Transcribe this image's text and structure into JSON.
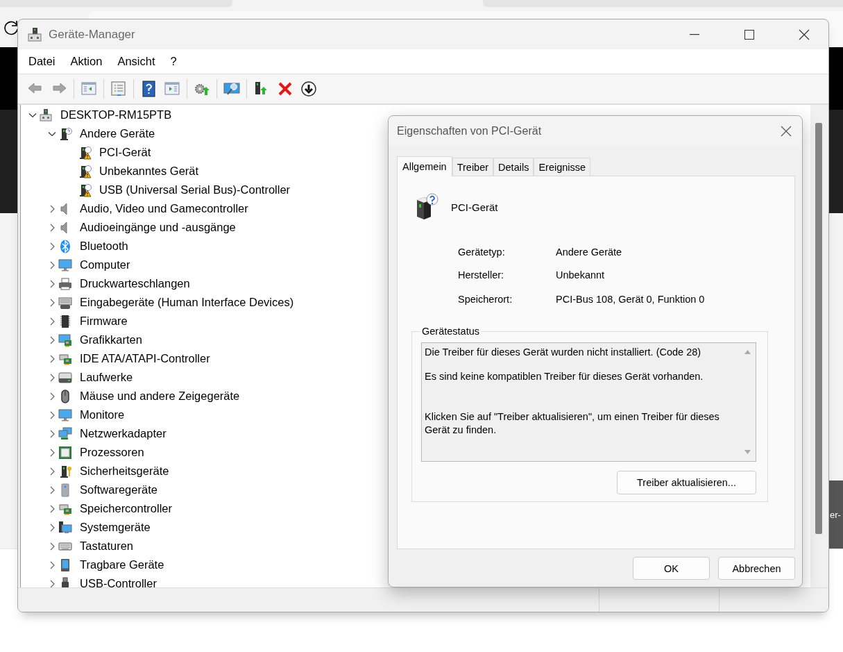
{
  "background": {
    "side_text": "er-"
  },
  "window": {
    "title": "Geräte-Manager"
  },
  "menu": [
    {
      "label": "Datei"
    },
    {
      "label": "Aktion"
    },
    {
      "label": "Ansicht"
    },
    {
      "label": "?"
    }
  ],
  "toolbar": {
    "groups": [
      [
        {
          "kind": "back",
          "disabled": true
        },
        {
          "kind": "forward",
          "disabled": true
        }
      ],
      [
        {
          "kind": "tree",
          "disabled": false
        }
      ],
      [
        {
          "kind": "properties",
          "disabled": false
        }
      ],
      [
        {
          "kind": "help",
          "disabled": false
        },
        {
          "kind": "pane",
          "disabled": false
        }
      ],
      [
        {
          "kind": "update",
          "disabled": false
        }
      ],
      [
        {
          "kind": "scan",
          "disabled": false
        }
      ],
      [
        {
          "kind": "enable",
          "disabled": false
        },
        {
          "kind": "remove",
          "disabled": false
        },
        {
          "kind": "download",
          "disabled": false
        }
      ]
    ]
  },
  "tree": [
    {
      "label": "DESKTOP-RM15PTB",
      "kind": "computer",
      "expanded": true,
      "children": [
        {
          "label": "Andere Geräte",
          "kind": "unknown",
          "expanded": true,
          "children": [
            {
              "label": "PCI-Gerät",
              "kind": "warning"
            },
            {
              "label": "Unbekanntes Gerät",
              "kind": "warning"
            },
            {
              "label": "USB (Universal Serial Bus)-Controller",
              "kind": "warning"
            }
          ]
        },
        {
          "label": "Audio, Video und Gamecontroller",
          "kind": "speaker",
          "expanded": false
        },
        {
          "label": "Audioeingänge und -ausgänge",
          "kind": "speaker",
          "expanded": false
        },
        {
          "label": "Bluetooth",
          "kind": "bluetooth",
          "expanded": false
        },
        {
          "label": "Computer",
          "kind": "monitor",
          "expanded": false
        },
        {
          "label": "Druckwarteschlangen",
          "kind": "printer",
          "expanded": false
        },
        {
          "label": "Eingabegeräte (Human Interface Devices)",
          "kind": "hid",
          "expanded": false
        },
        {
          "label": "Firmware",
          "kind": "chip",
          "expanded": false
        },
        {
          "label": "Grafikkarten",
          "kind": "display",
          "expanded": false
        },
        {
          "label": "IDE ATA/ATAPI-Controller",
          "kind": "card",
          "expanded": false
        },
        {
          "label": "Laufwerke",
          "kind": "drive",
          "expanded": false
        },
        {
          "label": "Mäuse und andere Zeigegeräte",
          "kind": "mouse",
          "expanded": false
        },
        {
          "label": "Monitore",
          "kind": "monitor",
          "expanded": false
        },
        {
          "label": "Netzwerkadapter",
          "kind": "network",
          "expanded": false
        },
        {
          "label": "Prozessoren",
          "kind": "cpu",
          "expanded": false
        },
        {
          "label": "Sicherheitsgeräte",
          "kind": "key",
          "expanded": false
        },
        {
          "label": "Softwaregeräte",
          "kind": "tower",
          "expanded": false
        },
        {
          "label": "Speichercontroller",
          "kind": "card",
          "expanded": false
        },
        {
          "label": "Systemgeräte",
          "kind": "system",
          "expanded": false
        },
        {
          "label": "Tastaturen",
          "kind": "keyboard",
          "expanded": false
        },
        {
          "label": "Tragbare Geräte",
          "kind": "portable",
          "expanded": false
        },
        {
          "label": "USB-Controller",
          "kind": "usb",
          "expanded": false
        }
      ]
    }
  ],
  "dialog": {
    "title": "Eigenschaften von PCI-Gerät",
    "tabs": [
      {
        "label": "Allgemein",
        "selected": true
      },
      {
        "label": "Treiber",
        "selected": false
      },
      {
        "label": "Details",
        "selected": false
      },
      {
        "label": "Ereignisse",
        "selected": false
      }
    ],
    "device_name": "PCI-Gerät",
    "properties": [
      {
        "label": "Gerätetyp:",
        "value": "Andere Geräte"
      },
      {
        "label": "Hersteller:",
        "value": "Unbekannt"
      },
      {
        "label": "Speicherort:",
        "value": "PCI-Bus 108, Gerät 0, Funktion 0"
      }
    ],
    "status": {
      "title": "Gerätestatus",
      "lines": [
        "Die Treiber für dieses Gerät wurden nicht installiert. (Code 28)",
        "Es sind keine kompatiblen Treiber für dieses Gerät vorhanden.",
        "Klicken Sie auf \"Treiber aktualisieren\", um einen Treiber für dieses Gerät zu finden."
      ],
      "button": "Treiber aktualisieren..."
    },
    "buttons": [
      "OK",
      "Abbrechen"
    ]
  }
}
